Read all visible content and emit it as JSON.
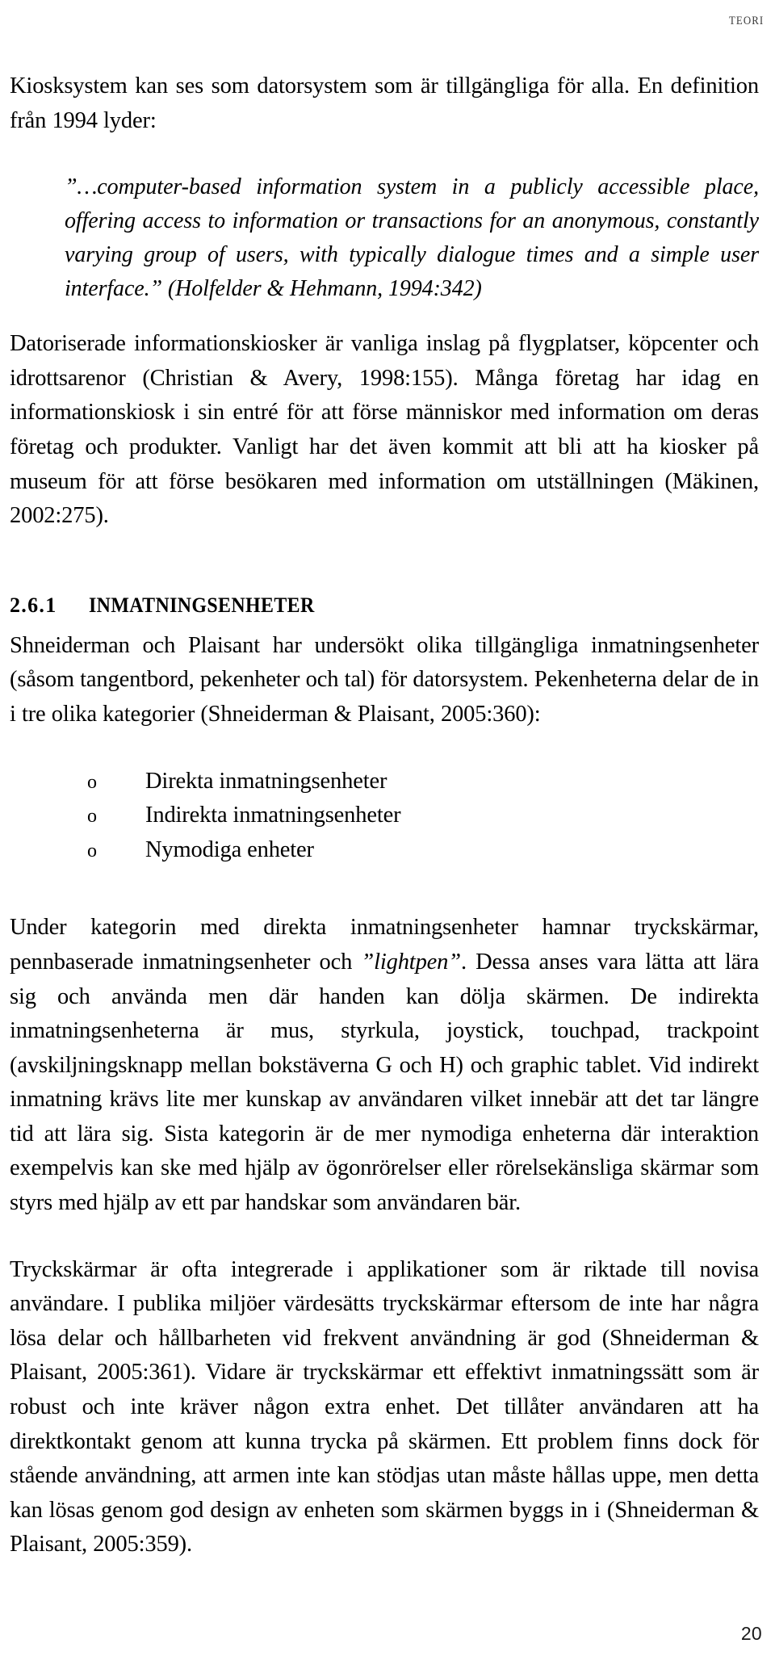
{
  "running_head": "TEORI",
  "folio": "20",
  "paragraphs": {
    "intro": "Kiosksystem kan ses som datorsystem som är tillgängliga för alla. En definition från 1994 lyder:",
    "quote_main": "”…computer-based information system in a publicly accessible place, offering access to information or transactions for an anonymous, constantly varying group of users, with typically dialogue times and a simple user interface.”",
    "quote_citation": " (Holfelder & Hehmann, 1994:342)",
    "kiosks": "Datoriserade informationskiosker är vanliga inslag på flygplatser, köpcenter och idrottsarenor (Christian & Avery, 1998:155). Många företag har idag en informationskiosk i sin entré för att förse människor med information om deras företag och produkter. Vanligt har det även kommit att bli att ha kiosker på museum för att förse besökaren med information om utställningen (Mäkinen, 2002:275).",
    "shneiderman_intro": "Shneiderman och Plaisant har undersökt olika tillgängliga inmatningsenheter (såsom tangentbord, pekenheter och tal) för datorsystem. Pekenheterna delar de in i tre olika kategorier (Shneiderman & Plaisant, 2005:360):",
    "categories_a": "Under kategorin med direkta inmatningsenheter hamnar tryckskärmar, pennbaserade inmatningsenheter och ",
    "categories_italic": "”lightpen”",
    "categories_b": ". Dessa anses vara lätta att lära sig och använda men där handen kan dölja skärmen. De indirekta inmatningsenheterna är mus, styrkula, joystick, touchpad, trackpoint (avskiljningsknapp mellan bokstäverna G och H) och graphic tablet. Vid indirekt inmatning krävs lite mer kunskap av användaren vilket innebär att det tar längre tid att lära sig. Sista kategorin är de mer nymodiga enheterna där interaktion exempelvis kan ske med hjälp av ögonrörelser eller rörelsekänsliga skärmar som styrs med hjälp av ett par handskar som användaren bär.",
    "touchscreens": "Tryckskärmar är ofta integrerade i applikationer som är riktade till novisa användare. I publika miljöer värdesätts tryckskärmar eftersom de inte har några lösa delar och hållbarheten vid frekvent användning är god (Shneiderman & Plaisant, 2005:361). Vidare är tryckskärmar ett effektivt inmatningssätt som är robust och inte kräver någon extra enhet. Det tillåter användaren att ha direktkontakt genom att kunna trycka på skärmen. Ett problem finns dock för stående användning, att armen inte kan stödjas utan måste hållas uppe, men detta kan lösas genom god design av enheten som skärmen byggs in i (Shneiderman & Plaisant, 2005:359)."
  },
  "heading": {
    "number": "2.6.1",
    "title": "INMATNINGSENHETER"
  },
  "list": {
    "marker": "o",
    "items": [
      "Direkta inmatningsenheter",
      "Indirekta inmatningsenheter",
      "Nymodiga enheter"
    ]
  }
}
